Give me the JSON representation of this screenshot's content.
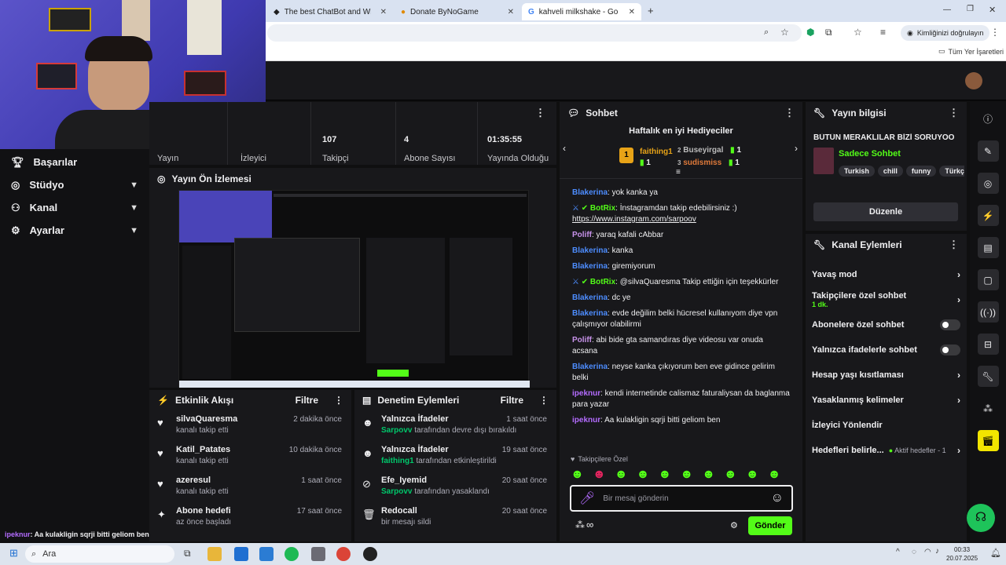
{
  "browser": {
    "tabs": [
      {
        "title": "The best ChatBot and Widgets",
        "icon": "chatbot-favicon"
      },
      {
        "title": "Donate ByNoGame",
        "icon": "bynogame-favicon"
      },
      {
        "title": "kahveli milkshake - Google'da Ara",
        "icon": "google-favicon"
      }
    ],
    "profile_label": "Kimliğinizi doğrulayın",
    "bookmarks_label": "Tüm Yer İşaretleri"
  },
  "sidebar": {
    "items": [
      {
        "label": "Başarılar",
        "icon": "trophy-icon",
        "expandable": false
      },
      {
        "label": "Stüdyo",
        "icon": "studio-icon",
        "expandable": true
      },
      {
        "label": "Kanal",
        "icon": "channel-icon",
        "expandable": true
      },
      {
        "label": "Ayarlar",
        "icon": "gear-icon",
        "expandable": true
      }
    ],
    "chat_overlay": {
      "user": "ipeknur",
      "text": ": Aa kulakligin sqrji bitti geliom ben"
    }
  },
  "stats": [
    {
      "value": "",
      "label": "Yayın"
    },
    {
      "value": "",
      "label": "İzleyici"
    },
    {
      "value": "107",
      "label": "Takipçi"
    },
    {
      "value": "4",
      "label": "Abone Sayısı"
    },
    {
      "value": "01:35:55",
      "label": "Yayında Olduğu"
    }
  ],
  "preview": {
    "title": "Yayın Ön İzlemesi"
  },
  "activity": {
    "title": "Etkinlik Akışı",
    "filter": "Filtre",
    "items": [
      {
        "user": "silvaQuaresma",
        "desc": "kanalı takip etti",
        "time": "2 dakika önce",
        "icon": "heart-icon"
      },
      {
        "user": "Katil_Patates",
        "desc": "kanalı takip etti",
        "time": "10 dakika önce",
        "icon": "heart-icon"
      },
      {
        "user": "azeresul",
        "desc": "kanalı takip etti",
        "time": "1 saat önce",
        "icon": "heart-icon"
      },
      {
        "user": "Abone hedefi",
        "desc": "az önce başladı",
        "time": "17 saat önce",
        "icon": "sparkle-icon"
      }
    ]
  },
  "moderation": {
    "title": "Denetim Eylemleri",
    "filter": "Filtre",
    "items": [
      {
        "title": "Yalnızca İfadeler",
        "actor": "Sarpovv",
        "desc": "tarafından devre dışı bırakıldı",
        "time": "1 saat önce",
        "icon": "emote-icon"
      },
      {
        "title": "Yalnızca İfadeler",
        "actor": "faithing1",
        "desc": "tarafından etkinleştirildi",
        "time": "19 saat önce",
        "icon": "emote-icon"
      },
      {
        "title": "Efe_Iyemid",
        "actor": "Sarpovv",
        "desc": "tarafından yasaklandı",
        "time": "20 saat önce",
        "icon": "ban-icon"
      },
      {
        "title": "Redocall",
        "actor": "",
        "desc": "bir mesajı sildi",
        "time": "20 saat önce",
        "icon": "trash-icon"
      }
    ]
  },
  "chat": {
    "title": "Sohbet",
    "gifters_title": "Haftalık en iyi Hediyeciler",
    "gifters": [
      {
        "name": "faithing1",
        "count": "1",
        "rank": "1"
      },
      {
        "name": "Buseyirgal",
        "count": "1",
        "rank": "2"
      },
      {
        "name": "sudismiss",
        "count": "1",
        "rank": "3"
      }
    ],
    "messages": [
      {
        "user": "Blakerina",
        "color": "#4d8dff",
        "text": ": yok kanka ya",
        "bot": false
      },
      {
        "user": "BotRix",
        "color": "#53fc18",
        "text": ": İnstagramdan takip edebilirsiniz :)",
        "link": "https://www.instagram.com/sarpoov",
        "bot": true
      },
      {
        "user": "Poliff",
        "color": "#c792ea",
        "text": ": yaraq kafali cAbbar",
        "bot": false
      },
      {
        "user": "Blakerina",
        "color": "#4d8dff",
        "text": ": kanka",
        "bot": false
      },
      {
        "user": "Blakerina",
        "color": "#4d8dff",
        "text": ": giremiyorum",
        "bot": false
      },
      {
        "user": "BotRix",
        "color": "#53fc18",
        "text": ": @silvaQuaresma Takip ettiğin için teşekkürler",
        "bot": true
      },
      {
        "user": "Blakerina",
        "color": "#4d8dff",
        "text": ": dc ye",
        "bot": false
      },
      {
        "user": "Blakerina",
        "color": "#4d8dff",
        "text": ": evde değilim belki hücresel kullanıyom diye vpn çalışmıyor olabilirmi",
        "bot": false
      },
      {
        "user": "Poliff",
        "color": "#c792ea",
        "text": ": abi bide gta samandıras diye videosu var onuda acsana",
        "bot": false
      },
      {
        "user": "Blakerina",
        "color": "#4d8dff",
        "text": ": neyse kanka çıkıyorum ben eve gidince gelirim belki",
        "bot": false
      },
      {
        "user": "ipeknur",
        "color": "#b46cff",
        "text": ": kendi internetinde calismaz faturaliysan da baglanma para yazar",
        "bot": false
      },
      {
        "user": "ipeknur",
        "color": "#b46cff",
        "text": ": Aa kulakligin sqrji bitti geliom ben",
        "bot": false
      }
    ],
    "followers_only": "Takipçilere Özel",
    "placeholder": "Bir mesaj gönderin",
    "send_label": "Gönder"
  },
  "stream_info": {
    "title": "Yayın bilgisi",
    "stream_title": "BÜTÜN MERAKLILAR BİZİ SORUYOO",
    "category": "Sadece Sohbet",
    "tags": [
      "Turkish",
      "chill",
      "funny",
      "Türkçe"
    ],
    "edit_label": "Düzenle"
  },
  "channel_actions": {
    "title": "Kanal Eylemleri",
    "items": [
      {
        "label": "Yavaş mod",
        "control": "chevron",
        "sub": ""
      },
      {
        "label": "Takipçilere özel sohbet",
        "control": "chevron",
        "sub": "1 dk."
      },
      {
        "label": "Abonelere özel sohbet",
        "control": "toggle",
        "sub": ""
      },
      {
        "label": "Yalnızca ifadelerle sohbet",
        "control": "toggle",
        "sub": ""
      },
      {
        "label": "Hesap yaşı kısıtlaması",
        "control": "chevron",
        "sub": ""
      },
      {
        "label": "Yasaklanmış kelimeler",
        "control": "chevron",
        "sub": ""
      },
      {
        "label": "İzleyici Yönlendir",
        "control": "none",
        "sub": ""
      },
      {
        "label": "Hedefleri belirle...",
        "control": "chevron",
        "sub": "Aktif hedefler - 1"
      }
    ]
  },
  "taskbar": {
    "search_label": "Ara",
    "time": "00:33",
    "date": "20.07.2025"
  },
  "colors": {
    "accent": "#53fc18",
    "panel": "#18181b",
    "bg": "#0f0f10"
  }
}
